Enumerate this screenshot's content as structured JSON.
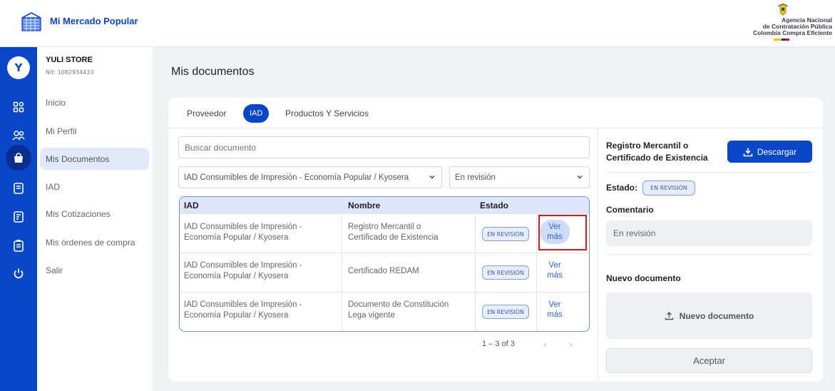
{
  "header": {
    "brand_title": "Mi Mercado Popular",
    "agency_line1": "Agencia Nacional",
    "agency_line2": "de Contratación Pública",
    "agency_line3": "Colombia Compra Eficiente"
  },
  "rail": {
    "avatar_letter": "Y",
    "icons": [
      "home-grid-icon",
      "users-icon",
      "shopping-bag-icon",
      "document-icon",
      "quote-icon",
      "clipboard-icon",
      "power-icon"
    ]
  },
  "sidebar": {
    "store_name": "YULI STORE",
    "store_nit": "Nit: 1082934433",
    "items": [
      {
        "label": "Inicio"
      },
      {
        "label": "Mi Perfil"
      },
      {
        "label": "Mis Documentos"
      },
      {
        "label": "IAD"
      },
      {
        "label": "Mis Cotizaciones"
      },
      {
        "label": "Mis órdenes de compra"
      },
      {
        "label": "Salir"
      }
    ],
    "active_item": "Mis Documentos"
  },
  "main": {
    "title": "Mis documentos",
    "tabs": [
      {
        "label": "Proveedor"
      },
      {
        "label": "IAD"
      },
      {
        "label": "Productos Y Servicios"
      }
    ],
    "active_tab": "IAD",
    "search": {
      "placeholder": "Buscar documento"
    },
    "filter_iad": {
      "value": "IAD Consumibles de Impresión - Economía Popular / Kyosera"
    },
    "filter_estado": {
      "value": "En revisión"
    },
    "table": {
      "headers": [
        "IAD",
        "Nombre",
        "Estado"
      ],
      "rows": [
        {
          "iad_line1": "IAD Consumibles de Impresión -",
          "iad_line2": "Economía Popular / Kyosera",
          "nombre_line1": "Registro Mercantil o",
          "nombre_line2": "Certificado de Existencia",
          "estado": "EN REVISIÓN",
          "action_line1": "Ver",
          "action_line2": "más"
        },
        {
          "iad_line1": "IAD Consumibles de Impresión -",
          "iad_line2": "Economía Popular / Kyosera",
          "nombre_line1": "Certificado REDAM",
          "nombre_line2": "",
          "estado": "EN REVISIÓN",
          "action_line1": "Ver",
          "action_line2": "más"
        },
        {
          "iad_line1": "IAD Consumibles de Impresión -",
          "iad_line2": "Economía Popular / Kyosera",
          "nombre_line1": "Documento de Constitución",
          "nombre_line2": "Lega vigente",
          "estado": "EN REVISIÓN",
          "action_line1": "Ver",
          "action_line2": "más"
        }
      ]
    },
    "pagination": {
      "label": "1 – 3 of 3",
      "prev": "‹",
      "next": "›"
    }
  },
  "detail": {
    "doc_title_line1": "Registro Mercantil o",
    "doc_title_line2": "Certificado de Existencia",
    "download_label": "Descargar",
    "estado_label": "Estado:",
    "estado_value": "EN REVISIÓN",
    "comentario_label": "Comentario",
    "comentario_value": "En revisión",
    "nuevo_label": "Nuevo documento",
    "upload_label": "Nuevo documento",
    "accept_label": "Aceptar"
  },
  "colors": {
    "primary": "#0a46c8",
    "highlight": "#e01818",
    "badge_bg": "#e6edfc"
  }
}
